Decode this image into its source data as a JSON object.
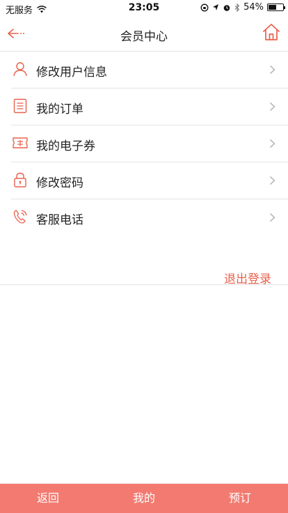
{
  "status_bar": {
    "carrier": "无服务",
    "time": "23:05",
    "battery_percent": "54%",
    "battery_level": 0.54,
    "icons": [
      "wifi-icon",
      "rotation-lock-icon",
      "location-icon",
      "alarm-icon",
      "bluetooth-icon",
      "battery-icon"
    ]
  },
  "nav": {
    "title": "会员中心",
    "back_icon": "back-arrow-icon",
    "home_icon": "home-icon"
  },
  "menu": {
    "items": [
      {
        "label": "修改用户信息",
        "icon": "user-icon"
      },
      {
        "label": "我的订单",
        "icon": "order-list-icon"
      },
      {
        "label": "我的电子券",
        "icon": "coupon-icon"
      },
      {
        "label": "修改密码",
        "icon": "lock-icon"
      },
      {
        "label": "客服电话",
        "icon": "phone-icon"
      }
    ]
  },
  "logout": {
    "label": "退出登录"
  },
  "tabs": [
    {
      "label": "返回"
    },
    {
      "label": "我的"
    },
    {
      "label": "预订"
    }
  ],
  "colors": {
    "accent": "#e8604d",
    "tab_bar": "#f27a70"
  }
}
